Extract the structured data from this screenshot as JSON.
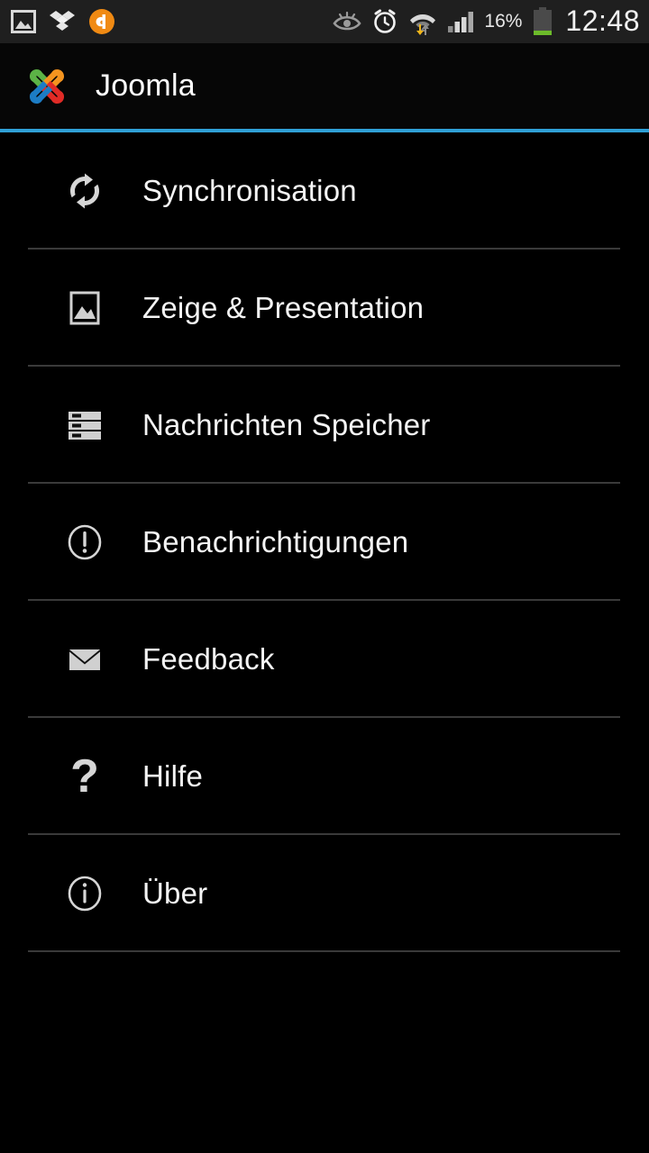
{
  "status_bar": {
    "background_color": "#1f1f1f",
    "left_icons": [
      {
        "name": "gallery-icon",
        "label": "Gallery"
      },
      {
        "name": "dropbox-icon",
        "label": "Dropbox"
      },
      {
        "name": "avast-icon",
        "label": "Avast"
      }
    ],
    "right_icons": [
      {
        "name": "smart-stay-eye-icon",
        "label": "Smart stay"
      },
      {
        "name": "alarm-clock-icon",
        "label": "Alarm"
      },
      {
        "name": "wifi-transfer-icon",
        "label": "Wi-Fi"
      },
      {
        "name": "signal-bars-icon",
        "label": "Signal"
      }
    ],
    "battery_percent": "16%",
    "battery_level": 16,
    "battery_fill_color": "#6cbb2a",
    "clock": "12:48"
  },
  "action_bar": {
    "title": "Joomla",
    "logo_name": "joomla-logo",
    "logo_colors": {
      "green": "#5cb346",
      "orange": "#f4941f",
      "red": "#e02b26",
      "blue": "#1c7cc4"
    },
    "accent_color": "#2f9fd6"
  },
  "menu": {
    "items": [
      {
        "label": "Synchronisation",
        "icon": "sync-icon"
      },
      {
        "label": "Zeige & Presentation",
        "icon": "image-icon"
      },
      {
        "label": "Nachrichten Speicher",
        "icon": "storage-icon"
      },
      {
        "label": "Benachrichtigungen",
        "icon": "alert-circle-icon"
      },
      {
        "label": "Feedback",
        "icon": "mail-icon"
      },
      {
        "label": "Hilfe",
        "icon": "question-mark-icon"
      },
      {
        "label": "Über",
        "icon": "info-circle-icon"
      }
    ],
    "text_color": "#f4f4f4",
    "divider_color": "#3a3a3a"
  }
}
